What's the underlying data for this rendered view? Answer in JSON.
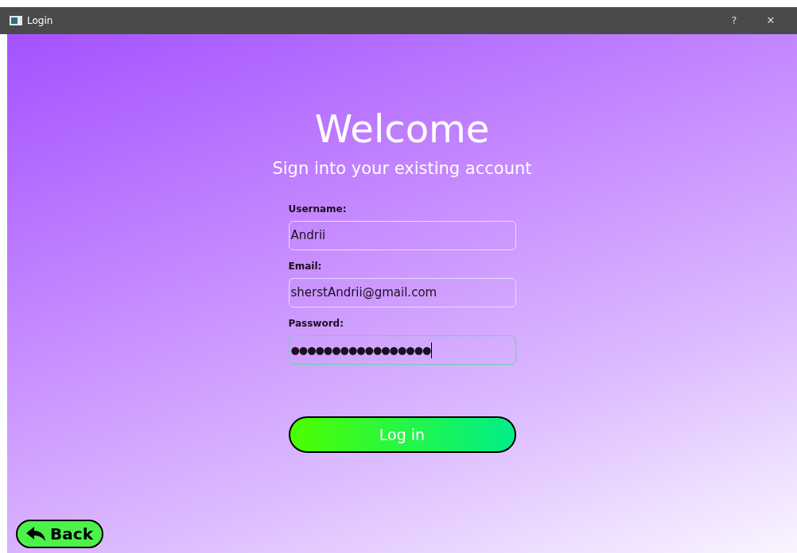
{
  "window": {
    "title": "Login",
    "buttons": [
      "?",
      "✕"
    ]
  },
  "heading": "Welcome",
  "subtitle": "Sign into your existing account",
  "fields": [
    {
      "label": "Username:",
      "value": "Andrii",
      "focused": false
    },
    {
      "label": "Email:",
      "value": "sherstAndrii@gmail.com",
      "focused": false
    },
    {
      "label": "Password:",
      "value": "●●●●●●●●●●●●●●●●●",
      "focused": true
    }
  ],
  "login_button": "Log in",
  "back_button": "Back"
}
